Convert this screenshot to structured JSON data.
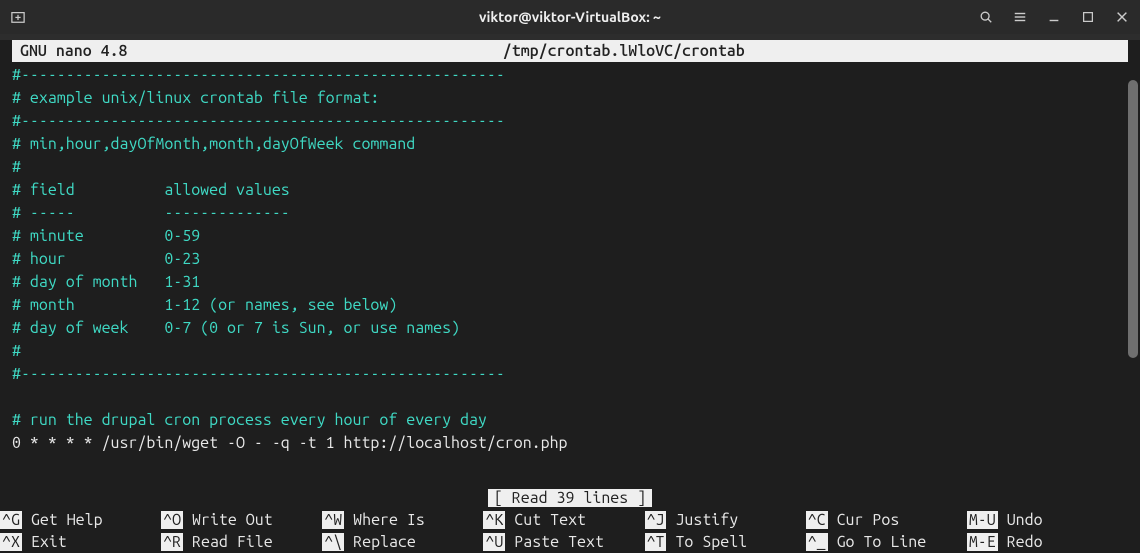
{
  "window": {
    "title": "viktor@viktor-VirtualBox: ~"
  },
  "nano": {
    "app": "GNU nano 4.8",
    "file_path": "/tmp/crontab.lWloVC/crontab",
    "status": "[ Read 39 lines ]"
  },
  "content": {
    "lines": [
      {
        "comment": true,
        "text": "#------------------------------------------------------"
      },
      {
        "comment": true,
        "text": "# example unix/linux crontab file format:"
      },
      {
        "comment": true,
        "text": "#------------------------------------------------------"
      },
      {
        "comment": true,
        "text": "# min,hour,dayOfMonth,month,dayOfWeek command"
      },
      {
        "comment": true,
        "text": "#"
      },
      {
        "comment": true,
        "text": "# field          allowed values"
      },
      {
        "comment": true,
        "text": "# -----          --------------"
      },
      {
        "comment": true,
        "text": "# minute         0-59"
      },
      {
        "comment": true,
        "text": "# hour           0-23"
      },
      {
        "comment": true,
        "text": "# day of month   1-31"
      },
      {
        "comment": true,
        "text": "# month          1-12 (or names, see below)"
      },
      {
        "comment": true,
        "text": "# day of week    0-7 (0 or 7 is Sun, or use names)"
      },
      {
        "comment": true,
        "text": "#"
      },
      {
        "comment": true,
        "text": "#------------------------------------------------------"
      },
      {
        "comment": false,
        "text": ""
      },
      {
        "comment": true,
        "text": "# run the drupal cron process every hour of every day"
      },
      {
        "comment": false,
        "text": "0 * * * * /usr/bin/wget -O - -q -t 1 http://localhost/cron.php"
      }
    ]
  },
  "shortcuts": {
    "row1": [
      {
        "key": "^G",
        "label": "Get Help"
      },
      {
        "key": "^O",
        "label": "Write Out"
      },
      {
        "key": "^W",
        "label": "Where Is"
      },
      {
        "key": "^K",
        "label": "Cut Text"
      },
      {
        "key": "^J",
        "label": "Justify"
      },
      {
        "key": "^C",
        "label": "Cur Pos"
      },
      {
        "key": "M-U",
        "label": "Undo"
      }
    ],
    "row2": [
      {
        "key": "^X",
        "label": "Exit"
      },
      {
        "key": "^R",
        "label": "Read File"
      },
      {
        "key": "^\\",
        "label": "Replace"
      },
      {
        "key": "^U",
        "label": "Paste Text"
      },
      {
        "key": "^T",
        "label": "To Spell"
      },
      {
        "key": "^_",
        "label": "Go To Line"
      },
      {
        "key": "M-E",
        "label": "Redo"
      }
    ]
  }
}
